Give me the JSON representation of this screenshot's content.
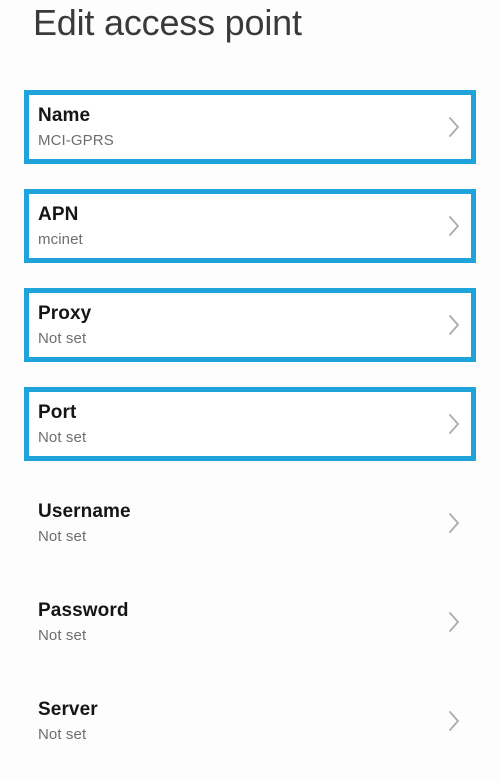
{
  "header": {
    "title": "Edit access point"
  },
  "theme": {
    "highlight_color": "#1FA3DB",
    "title_color": "#3A3A3A",
    "row_title_color": "#151515",
    "row_subtitle_color": "#6E6E6E",
    "chevron_color": "#ACACAC",
    "background_color": "#FDFDFD"
  },
  "settings_list": {
    "rows": [
      {
        "name": "name",
        "label": "Name",
        "value": "MCI-GPRS",
        "highlighted": true,
        "chevron_icon": "chevron-right-icon"
      },
      {
        "name": "apn",
        "label": "APN",
        "value": "mcinet",
        "highlighted": true,
        "chevron_icon": "chevron-right-icon"
      },
      {
        "name": "proxy",
        "label": "Proxy",
        "value": "Not set",
        "highlighted": true,
        "chevron_icon": "chevron-right-icon"
      },
      {
        "name": "port",
        "label": "Port",
        "value": "Not set",
        "highlighted": true,
        "chevron_icon": "chevron-right-icon"
      },
      {
        "name": "username",
        "label": "Username",
        "value": "Not set",
        "highlighted": false,
        "chevron_icon": "chevron-right-icon"
      },
      {
        "name": "password",
        "label": "Password",
        "value": "Not set",
        "highlighted": false,
        "chevron_icon": "chevron-right-icon"
      },
      {
        "name": "server",
        "label": "Server",
        "value": "Not set",
        "highlighted": false,
        "chevron_icon": "chevron-right-icon"
      }
    ]
  }
}
